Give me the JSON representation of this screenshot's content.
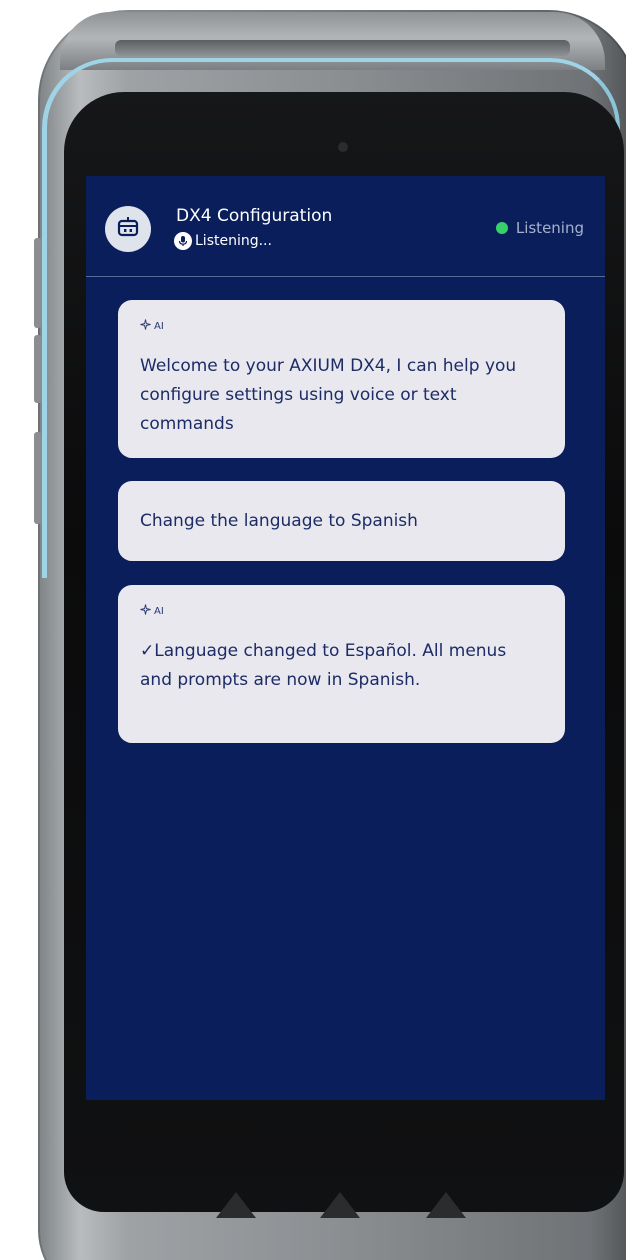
{
  "header": {
    "title": "DX4 Configuration",
    "subtitle": "Listening...",
    "status": "Listening",
    "status_color": "#37d167",
    "avatar_icon": "robot-icon",
    "subtitle_icon": "microphone-icon"
  },
  "messages": [
    {
      "role": "ai",
      "tag": "AI",
      "tag_icon": "sparkle-icon",
      "text": "Welcome to your AXIUM DX4, I can help you configure settings using voice or text commands"
    },
    {
      "role": "user",
      "text": "Change the language to Spanish"
    },
    {
      "role": "ai",
      "tag": "AI",
      "tag_icon": "sparkle-icon",
      "text": "✓Language changed to Español. All menus and prompts are now in Spanish."
    }
  ],
  "theme": {
    "screen_background": "#0b1e5c",
    "bubble_background": "#e8e8ee",
    "bubble_text": "#1d2c66"
  }
}
